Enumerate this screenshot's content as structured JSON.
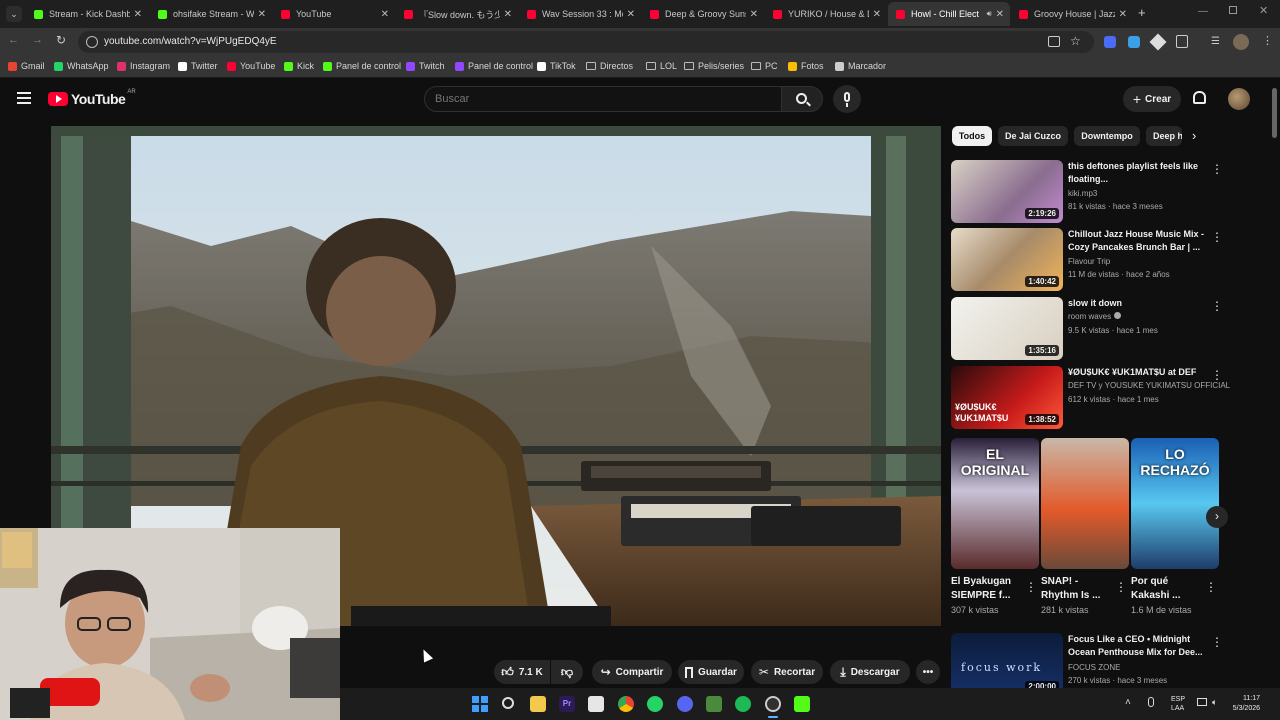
{
  "browser": {
    "tabs": [
      {
        "title": "Stream - Kick Dashbo",
        "color": "#53fc18"
      },
      {
        "title": "ohsifake Stream - W",
        "color": "#53fc18"
      },
      {
        "title": "YouTube",
        "color": "#ff0033"
      },
      {
        "title": "『Slow down. もう少し",
        "color": "#ff0033"
      },
      {
        "title": "Wav Session 33 : Mo",
        "color": "#ff0033"
      },
      {
        "title": "Deep & Groovy Suns",
        "color": "#ff0033"
      },
      {
        "title": "YURIKO / House & D",
        "color": "#ff0033"
      },
      {
        "title": "Howl - Chill Elect",
        "color": "#ff0033"
      },
      {
        "title": "Groovy House | Jazz",
        "color": "#ff0033"
      }
    ],
    "url": "youtube.com/watch?v=WjPUgEDQ4yE",
    "bookmarks": [
      {
        "label": "Gmail",
        "icon": "gmail-icon",
        "color": "#ea4335"
      },
      {
        "label": "WhatsApp",
        "icon": "whatsapp-icon",
        "color": "#25d366"
      },
      {
        "label": "Instagram",
        "icon": "instagram-icon",
        "color": "#e1306c"
      },
      {
        "label": "Twitter",
        "icon": "x-icon",
        "color": "#ffffff"
      },
      {
        "label": "YouTube",
        "icon": "youtube-icon",
        "color": "#ff0033"
      },
      {
        "label": "Kick",
        "icon": "kick-icon",
        "color": "#53fc18"
      },
      {
        "label": "Panel de control",
        "icon": "kick-icon",
        "color": "#53fc18"
      },
      {
        "label": "Twitch",
        "icon": "twitch-icon",
        "color": "#9146ff"
      },
      {
        "label": "Panel de control",
        "icon": "twitch-icon",
        "color": "#9146ff"
      },
      {
        "label": "TikTok",
        "icon": "tiktok-icon",
        "color": "#ffffff"
      },
      {
        "label": "Directos",
        "icon": "folder-icon",
        "color": ""
      },
      {
        "label": "LOL",
        "icon": "folder-icon",
        "color": ""
      },
      {
        "label": "Pelis/series",
        "icon": "folder-icon",
        "color": ""
      },
      {
        "label": "PC",
        "icon": "folder-icon",
        "color": ""
      },
      {
        "label": "Fotos",
        "icon": "photos-icon",
        "color": "#fbbc04"
      },
      {
        "label": "Marcador",
        "icon": "globe-icon",
        "color": "#cccccc"
      }
    ]
  },
  "youtube": {
    "logo_text": "YouTube",
    "region": "AR",
    "search_placeholder": "Buscar",
    "create_label": "Crear",
    "accent": "#ff0033",
    "actions": {
      "likes": "7.1 K",
      "share": "Compartir",
      "save": "Guardar",
      "clip": "Recortar",
      "download": "Descargar"
    },
    "chips": [
      "Todos",
      "De Jai Cuzco",
      "Downtempo",
      "Deep h"
    ],
    "recommendations": [
      {
        "title": "this deftones playlist feels like floating...",
        "channel": "kiki.mp3",
        "views": "81 k vistas · hace 3 meses",
        "duration": "2:19:26",
        "verified": false
      },
      {
        "title": "Chillout Jazz House Music Mix - Cozy Pancakes Brunch Bar | ...",
        "channel": "Flavour Trip",
        "views": "11 M de vistas · hace 2 años",
        "duration": "1:40:42",
        "verified": false
      },
      {
        "title": "slow it down",
        "channel": "room waves",
        "views": "9.5 K vistas · hace 1 mes",
        "duration": "1:35:16",
        "verified": true
      },
      {
        "title": "¥ØU$UK€ ¥UK1MAT$U at DEF",
        "channel": "DEF TV y YOUSUKE YUKIMATSU OFFICIAL",
        "views": "612 k vistas · hace 1 mes",
        "duration": "1:38:52",
        "verified": false
      }
    ],
    "shorts": [
      {
        "title": "El Byakugan SIEMPRE f...",
        "views": "307 k vistas",
        "overlay": "EL ORIGINAL"
      },
      {
        "title": "SNAP! - Rhythm Is ...",
        "views": "281 k vistas",
        "overlay": ""
      },
      {
        "title": "Por qué Kakashi ...",
        "views": "1.6 M de vistas",
        "overlay": "LO RECHAZÓ"
      }
    ],
    "rec_after": {
      "title": "Focus Like a CEO • Midnight Ocean Penthouse Mix for Dee...",
      "channel": "FOCUS ZONE",
      "views": "270 k vistas · hace 3 meses",
      "duration": "2:00:00",
      "thumb_text": "focus work"
    },
    "thumb_overlay_text": "¥ØU$UK€ ¥UK1MAT$U"
  },
  "taskbar": {
    "lang": "ESP",
    "lang2": "LAA",
    "time": "11:17",
    "date": "5/3/2026"
  }
}
